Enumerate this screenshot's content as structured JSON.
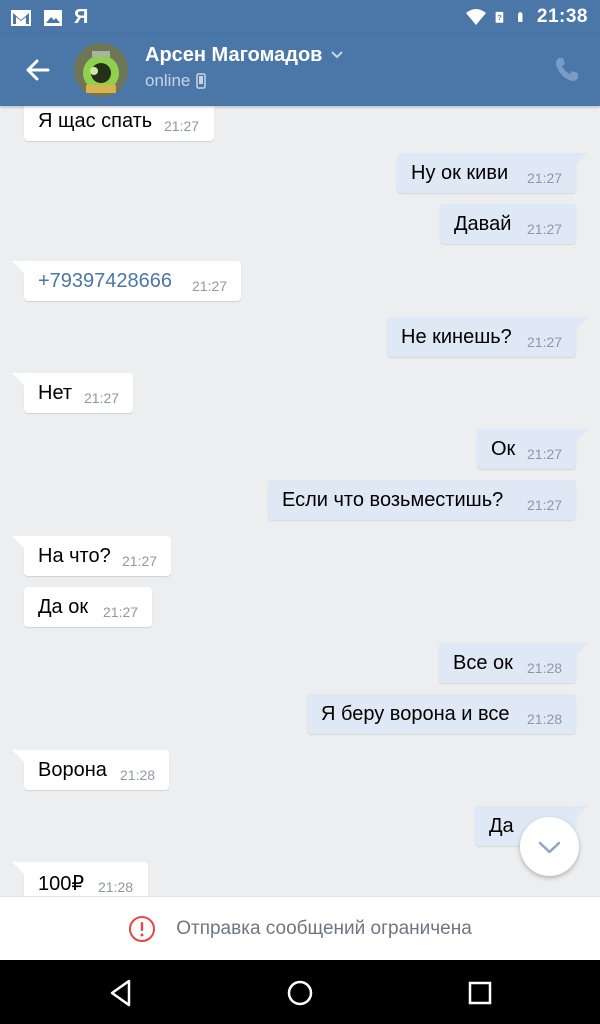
{
  "status_bar": {
    "time": "21:38",
    "left_icons": [
      "gmail-icon",
      "image-icon",
      "yandex-icon"
    ],
    "right_icons": [
      "wifi-icon",
      "signal-icon",
      "battery-icon"
    ],
    "yandex_glyph": "Я"
  },
  "header": {
    "name": "Арсен Магомадов",
    "status": "online"
  },
  "messages": [
    {
      "dir": "in",
      "text": "Я щас спать",
      "time": "21:27"
    },
    {
      "dir": "out",
      "text": "Ну ок киви",
      "time": "21:27"
    },
    {
      "dir": "out",
      "text": "Давай",
      "time": "21:27"
    },
    {
      "dir": "in",
      "text": "+79397428666",
      "time": "21:27",
      "link": true
    },
    {
      "dir": "out",
      "text": "Не кинешь?",
      "time": "21:27"
    },
    {
      "dir": "in",
      "text": "Нет",
      "time": "21:27"
    },
    {
      "dir": "out",
      "text": "Ок",
      "time": "21:27"
    },
    {
      "dir": "out",
      "text": "Если что возьместишь?",
      "time": "21:27"
    },
    {
      "dir": "in",
      "text": "На что?",
      "time": "21:27"
    },
    {
      "dir": "in",
      "text": "Да ок",
      "time": "21:27"
    },
    {
      "dir": "out",
      "text": "Все ок",
      "time": "21:28"
    },
    {
      "dir": "out",
      "text": "Я беру ворона и все",
      "time": "21:28"
    },
    {
      "dir": "in",
      "text": "Ворона",
      "time": "21:28"
    },
    {
      "dir": "out",
      "text": "Да",
      "time": ""
    },
    {
      "dir": "in",
      "text": "100₽",
      "time": "21:28"
    }
  ],
  "notice": {
    "text": "Отправка сообщений ограничена",
    "icon": "alert-circle-icon"
  },
  "navigation": {
    "icons": [
      "back-triangle-icon",
      "home-circle-icon",
      "recents-square-icon"
    ]
  },
  "colors": {
    "header": "#4a76a8",
    "chat_background": "#edeef0",
    "outgoing_bubble": "#dfe8f5",
    "incoming_bubble": "#ffffff",
    "link": "#4a76a8",
    "notice_icon": "#e64646"
  }
}
